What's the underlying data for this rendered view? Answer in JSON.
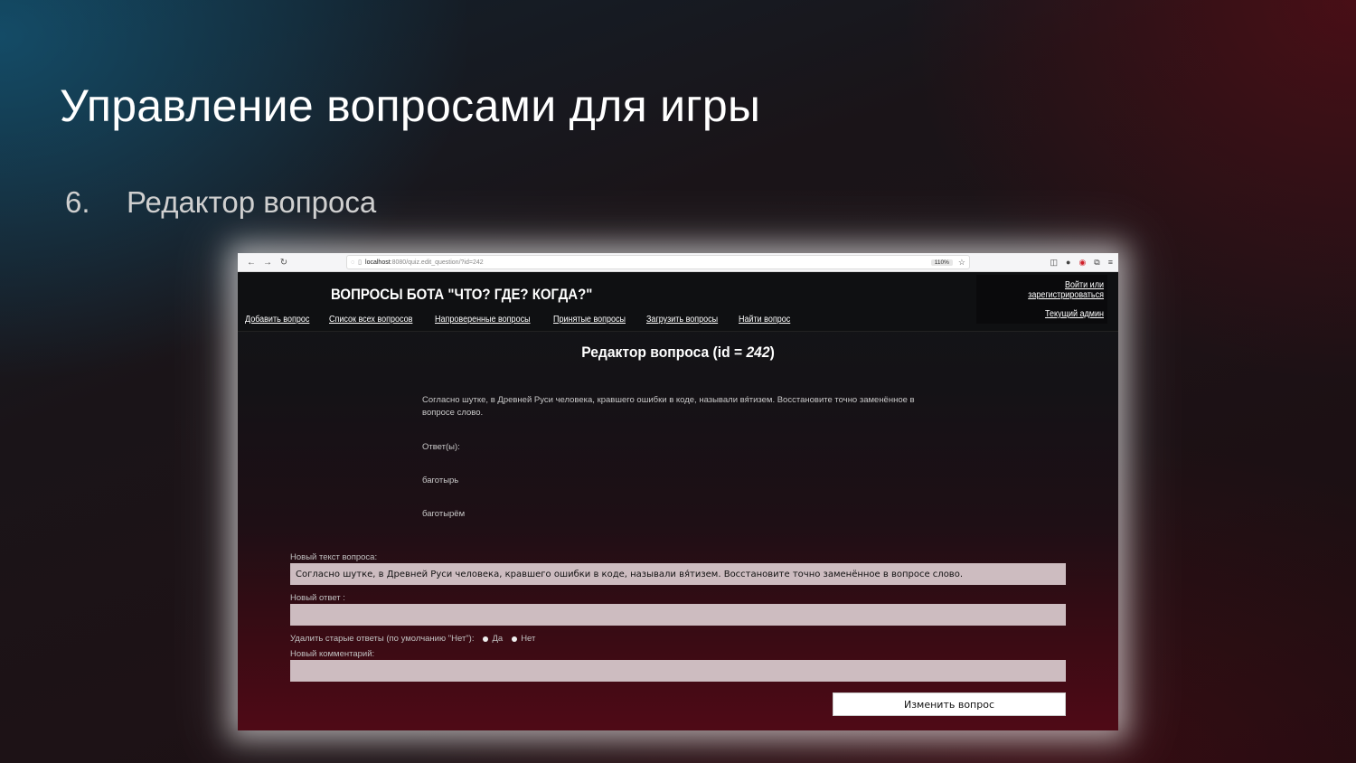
{
  "slide": {
    "title": "Управление вопросами для игры",
    "item_number": "6.",
    "item_text": "Редактор вопроса"
  },
  "browser": {
    "url_host": "localhost",
    "url_rest": ":8080/quiz.edit_question/?id=242",
    "zoom": "110%"
  },
  "app": {
    "title": "ВОПРОСЫ БОТА \"ЧТО? ГДЕ? КОГДА?\"",
    "nav": [
      "Добавить вопрос",
      "Список всех вопросов",
      "Напроверенные вопросы",
      "Принятые вопросы",
      "Загрузить вопросы",
      "Найти вопрос"
    ],
    "auth": {
      "login": "Войти или зарегистрироваться",
      "current_admin": "Текущий админ"
    },
    "editor": {
      "heading_prefix": "Редактор вопроса (id = ",
      "id": "242",
      "heading_suffix": ")",
      "question_text": "Согласно шутке, в Древней Руси человека, кравшего ошибки в коде, называли вя́тизем. Восстановите точно заменённое в вопросе слово.",
      "answers_label": "Ответ(ы):",
      "answers": [
        "баготырь",
        "баготырём"
      ]
    },
    "form": {
      "new_text_label": "Новый текст вопроса:",
      "new_text_value": "Согласно шутке, в Древней Руси человека, кравшего ошибки в коде, называли вя́тизем. Восстановите точно заменённое в вопросе слово.",
      "new_answer_label": "Новый ответ :",
      "new_answer_value": "",
      "delete_old_label": "Удалить старые ответы (по умолчанию \"Нет\"):",
      "option_yes": "Да",
      "option_no": "Нет",
      "new_comment_label": "Новый комментарий:",
      "new_comment_value": "",
      "submit": "Изменить вопрос"
    }
  }
}
